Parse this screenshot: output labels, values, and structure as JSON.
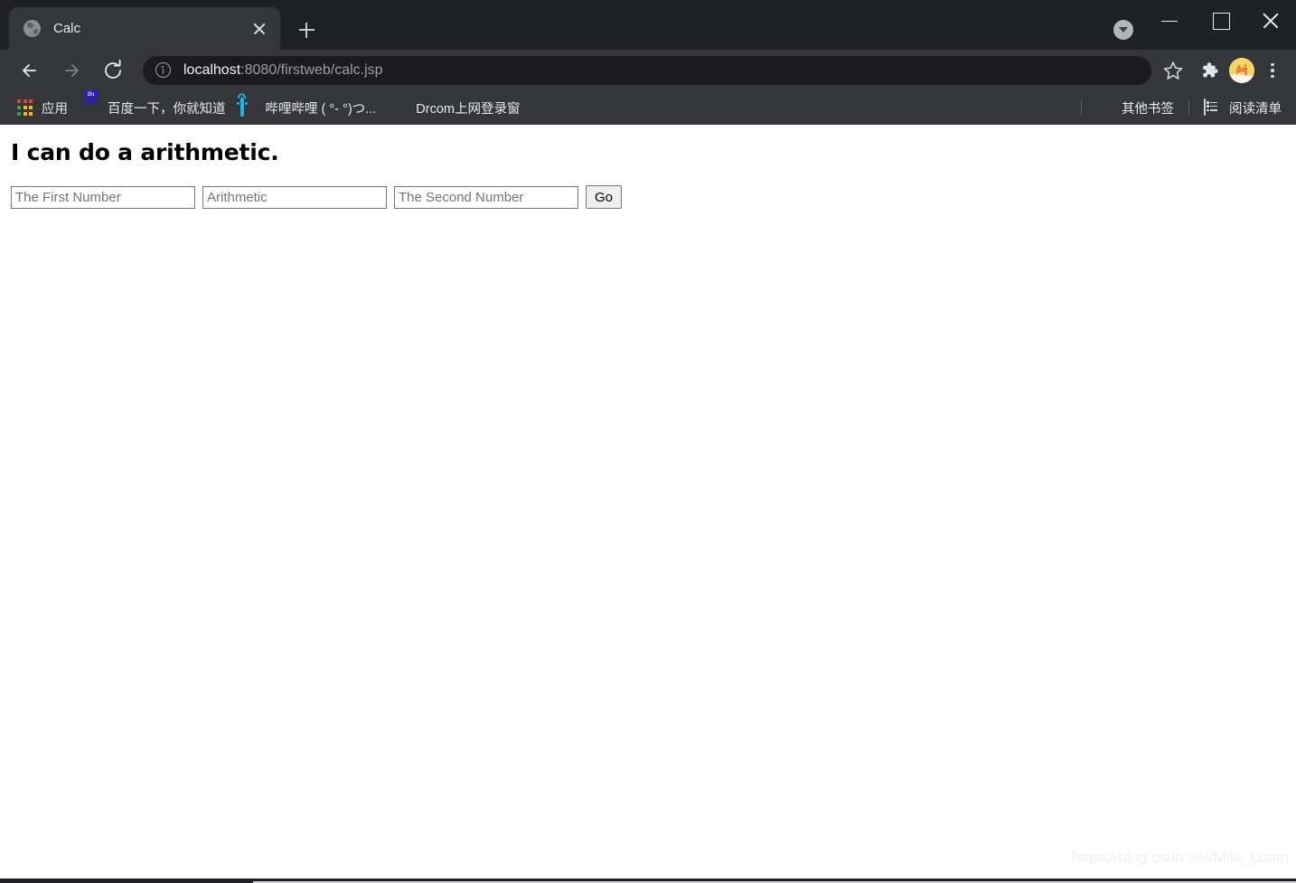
{
  "window": {
    "controls": {
      "minimize": "minimize-label",
      "maximize": "maximize-label",
      "close": "close-label"
    }
  },
  "tabstrip": {
    "tabs": [
      {
        "title": "Calc",
        "favicon": "globe-icon",
        "active": true
      }
    ],
    "new_tab_label": "+",
    "tab_search_label": "Search tabs"
  },
  "toolbar": {
    "back_label": "Back",
    "forward_label": "Forward",
    "reload_label": "Reload",
    "security_icon": "info-circle-icon",
    "url_host": "localhost",
    "url_rest": ":8080/firstweb/calc.jsp",
    "url_full": "localhost:8080/firstweb/calc.jsp",
    "bookmark_star_label": "Bookmark this tab",
    "extensions_label": "Extensions",
    "profile_label": "Profile",
    "menu_label": "Customize and control Google Chrome"
  },
  "bookmarks": {
    "items": [
      {
        "label": "应用",
        "icon": "apps-grid-icon"
      },
      {
        "label": "百度一下，你就知道",
        "icon": "baidu-icon"
      },
      {
        "label": "哔哩哔哩 ( °- °)つ...",
        "icon": "bilibili-icon"
      },
      {
        "label": "Drcom上网登录窗",
        "icon": "globe-icon"
      }
    ],
    "right": [
      {
        "label": "其他书签",
        "icon": "folder-icon"
      },
      {
        "label": "阅读清单",
        "icon": "reading-list-icon"
      }
    ]
  },
  "page": {
    "heading": "I can do a arithmetic.",
    "fields": [
      {
        "name": "first-number",
        "placeholder": "The First Number",
        "value": ""
      },
      {
        "name": "arithmetic",
        "placeholder": "Arithmetic",
        "value": ""
      },
      {
        "name": "second-number",
        "placeholder": "The Second Number",
        "value": ""
      }
    ],
    "submit_label": "Go",
    "watermark": "https://blog.csdn.net/Milo_Luom"
  },
  "colors": {
    "chrome_dark": "#202124",
    "toolbar": "#35363a",
    "omnibox": "#1b1b1d",
    "text_light": "#e8eaed",
    "text_muted": "#9aa0a6",
    "page_bg": "#ffffff",
    "input_border": "#767676",
    "button_bg": "#efefef",
    "baidu_blue": "#2319dc",
    "bilibili_cyan": "#18b9e8",
    "folder_yellow": "#f7d36a"
  }
}
